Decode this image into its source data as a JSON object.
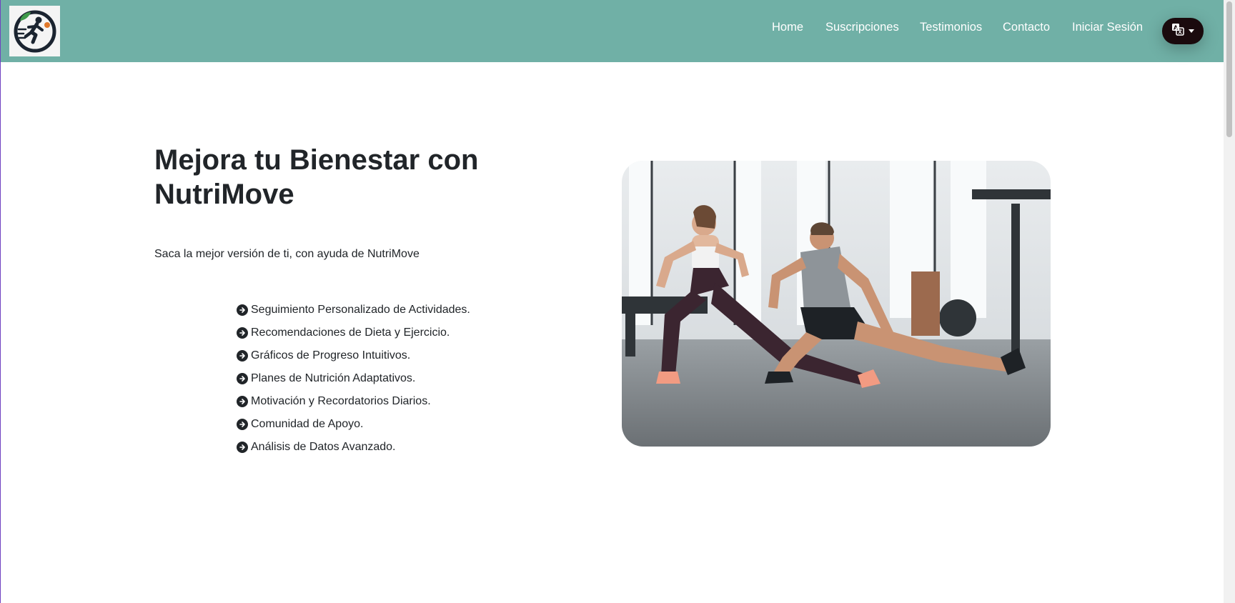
{
  "nav": {
    "logo_icon": "runner-logo",
    "links": [
      "Home",
      "Suscripciones",
      "Testimonios",
      "Contacto",
      "Iniciar Sesión"
    ],
    "language_icon": "translate-icon"
  },
  "hero": {
    "title": "Mejora tu Bienestar con NutriMove",
    "subtitle": "Saca la mejor versión de ti, con ayuda de NutriMove",
    "features": [
      "Seguimiento Personalizado de Actividades.",
      "Recomendaciones de Dieta y Ejercicio.",
      "Gráficos de Progreso Intuitivos.",
      "Planes de Nutrición Adaptativos.",
      "Motivación y Recordatorios Diarios.",
      "Comunidad de Apoyo.",
      "Análisis de Datos Avanzado."
    ],
    "image": "photo of a woman and a man doing side lunge stretches in a gym"
  },
  "colors": {
    "navbar": "#70b0a6",
    "language_button": "#1a0a0d",
    "text": "#212529"
  }
}
